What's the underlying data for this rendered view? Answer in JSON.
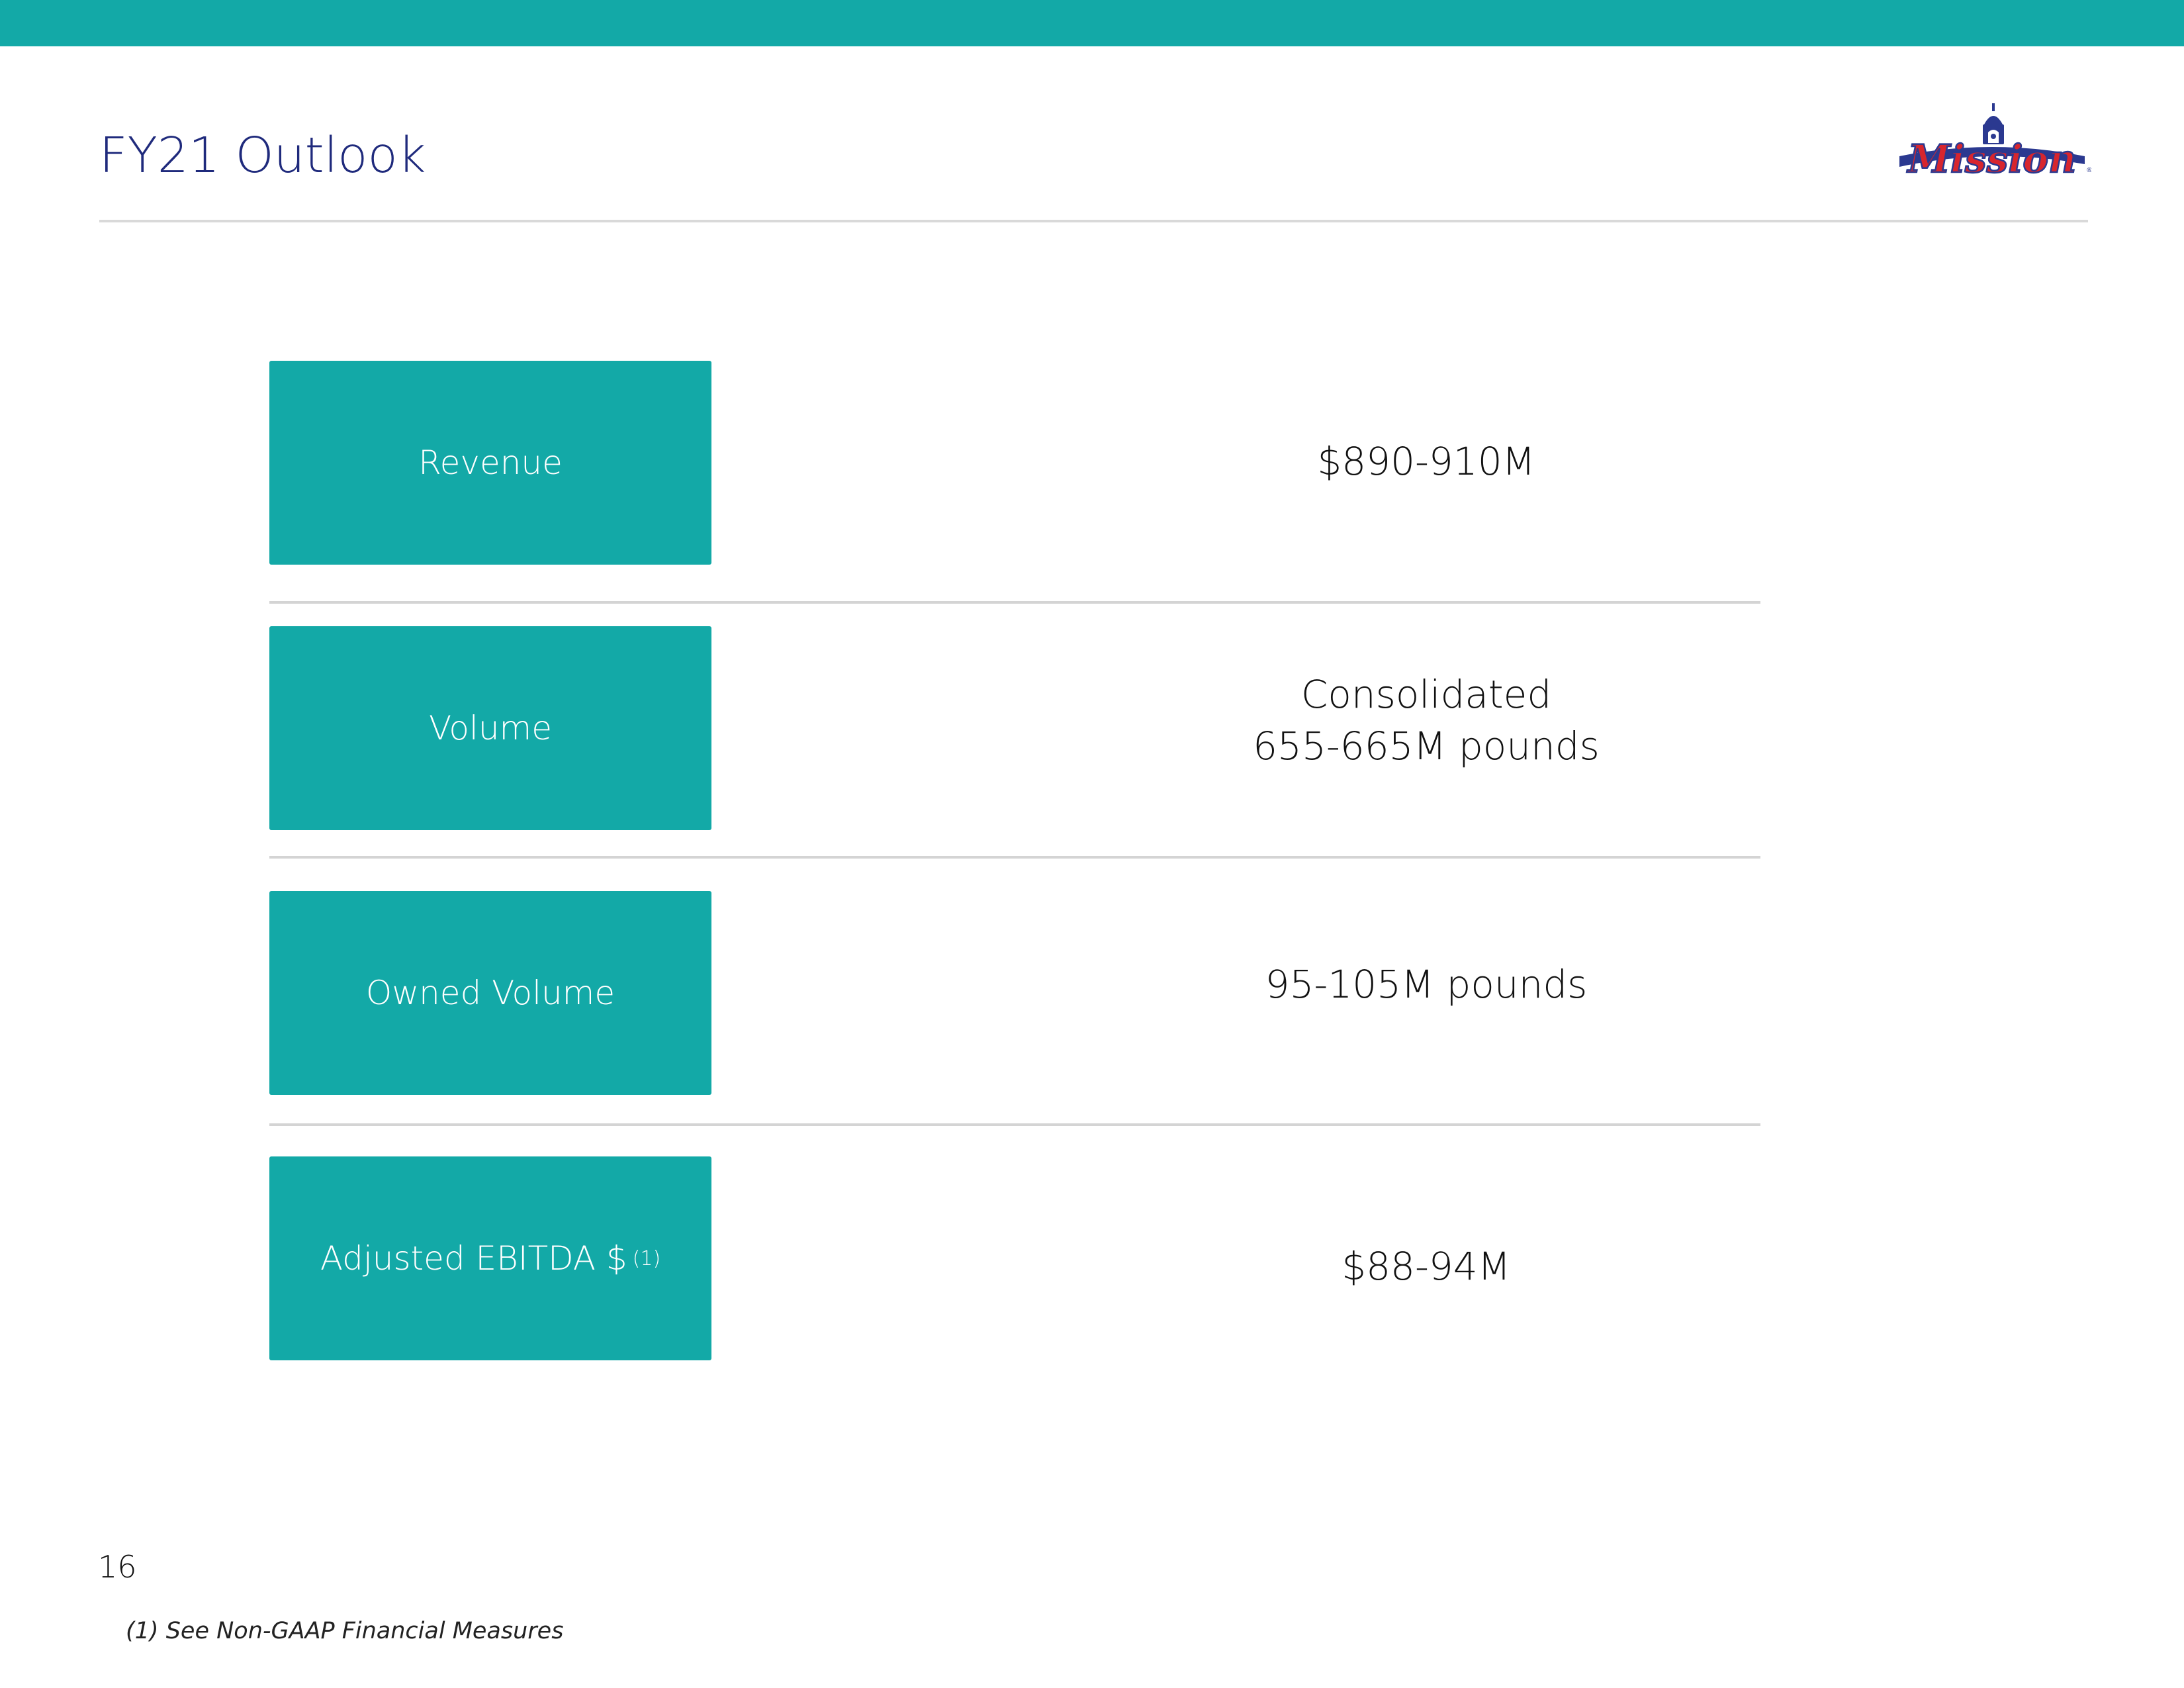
{
  "header": {
    "title": "FY21 Outlook",
    "logo_text": "Mission"
  },
  "rows": [
    {
      "label": "Revenue",
      "value_line1": "$890-910M",
      "value_line2": ""
    },
    {
      "label": "Volume",
      "value_line1": "Consolidated",
      "value_line2": "655-665M pounds"
    },
    {
      "label": "Owned Volume",
      "value_line1": "95-105M pounds",
      "value_line2": ""
    },
    {
      "label": "Adjusted EBITDA $",
      "label_sup": "(1)",
      "value_line1": "$88-94M",
      "value_line2": ""
    }
  ],
  "footer": {
    "page_number": "16",
    "footnote": "(1) See Non-GAAP Financial Measures"
  },
  "colors": {
    "accent": "#13a9a7",
    "title": "#1f2a7c",
    "logo_red": "#d7262e",
    "logo_blue": "#2b3990"
  }
}
